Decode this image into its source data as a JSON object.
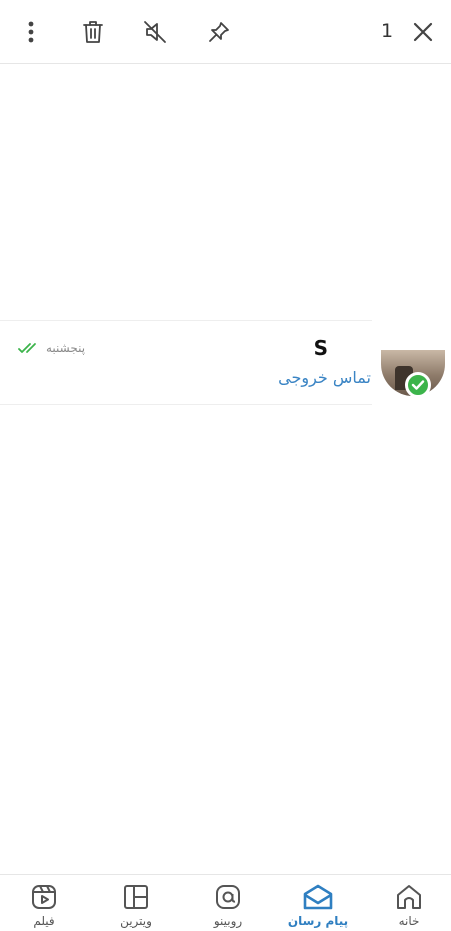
{
  "toolbar": {
    "selected_count": "1",
    "icons": [
      "close-icon",
      "pin-icon",
      "mute-icon",
      "delete-icon",
      "more-options-icon"
    ]
  },
  "chat": {
    "name": "S",
    "preview": "تماس خروجی",
    "time": "پنجشنبه",
    "status": "read",
    "avatar_badge": "check"
  },
  "bottom_nav": {
    "active": "messenger",
    "items": [
      {
        "id": "home",
        "label": "خانه",
        "icon": "home-icon"
      },
      {
        "id": "messenger",
        "label": "پیام رسان",
        "icon": "messenger-icon"
      },
      {
        "id": "rubino",
        "label": "روبینو",
        "icon": "at-icon"
      },
      {
        "id": "showcase",
        "label": "ویترین",
        "icon": "showcase-icon"
      },
      {
        "id": "film",
        "label": "فیلم",
        "icon": "film-icon"
      }
    ]
  },
  "colors": {
    "accent": "#2f7fc1",
    "preview_text": "#3a84c4",
    "read_ticks": "#3cb44b",
    "badge": "#3cb44b"
  }
}
